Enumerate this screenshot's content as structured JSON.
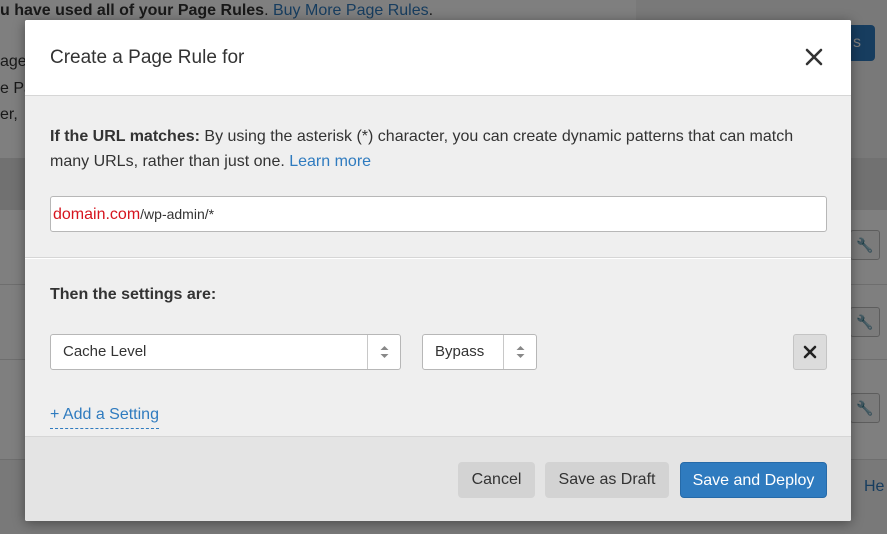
{
  "background": {
    "banner_bold": "u have used all of your Page Rules",
    "banner_link": "Buy More Page Rules",
    "banner_tail": ".",
    "side_lines": [
      "age R",
      "e Pa",
      "er,"
    ],
    "button_fragment": "s",
    "help_fragment": "He"
  },
  "modal": {
    "title": "Create a Page Rule for",
    "url_section": {
      "label": "If the URL matches:",
      "description": " By using the asterisk (*) character, you can create dynamic patterns that can match many URLs, rather than just one. ",
      "learn_more": "Learn more",
      "url_domain": "domain.com",
      "url_path": "/wp-admin/*"
    },
    "settings_section": {
      "label": "Then the settings are:",
      "setting_name": "Cache Level",
      "setting_value": "Bypass",
      "add_setting": "+ Add a Setting"
    },
    "footer": {
      "cancel": "Cancel",
      "save_draft": "Save as Draft",
      "save_deploy": "Save and Deploy"
    }
  },
  "colors": {
    "accent": "#2f7bbf",
    "domain_red": "#d6141e"
  },
  "icons": [
    "close-icon",
    "select-arrows-icon",
    "remove-icon",
    "wrench-icon"
  ]
}
